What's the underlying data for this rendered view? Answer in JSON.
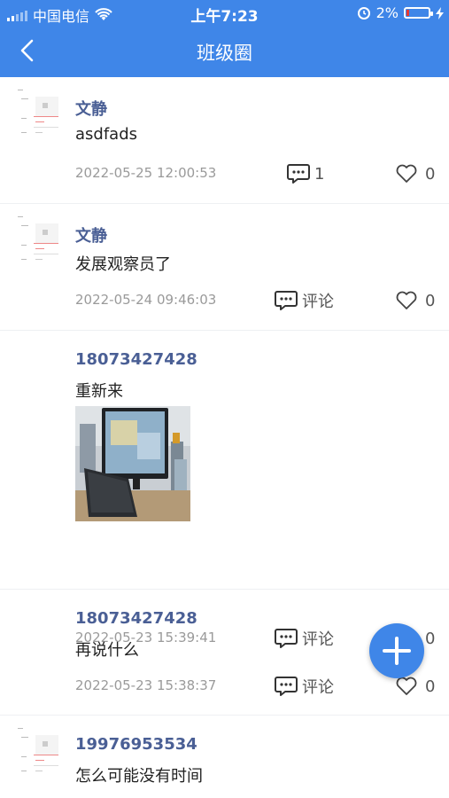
{
  "status_bar": {
    "carrier": "中国电信",
    "time": "上午7:23",
    "battery": "2%"
  },
  "navbar": {
    "title": "班级圈"
  },
  "posts": [
    {
      "author": "文静",
      "content": "asdfads",
      "time": "2022-05-25 12:00:53",
      "comment": "1",
      "likes": "0"
    },
    {
      "author": "文静",
      "content": "发展观察员了",
      "time": "2022-05-24 09:46:03",
      "comment": "评论",
      "likes": "0"
    },
    {
      "author": "18073427428",
      "content": "重新来",
      "time": "2022-05-23 15:39:41",
      "comment": "评论",
      "likes": "0"
    },
    {
      "author": "18073427428",
      "content": "再说什么",
      "time": "2022-05-23 15:38:37",
      "comment": "评论",
      "likes": "0"
    },
    {
      "author": "19976953534",
      "content": "怎么可能没有时间"
    }
  ],
  "colors": {
    "primary": "#3f86e8",
    "name": "#4a5f95"
  },
  "icons": [
    "back-arrow-icon",
    "wifi-icon",
    "alarm-icon",
    "charging-icon",
    "comment-icon",
    "heart-icon",
    "plus-icon"
  ]
}
